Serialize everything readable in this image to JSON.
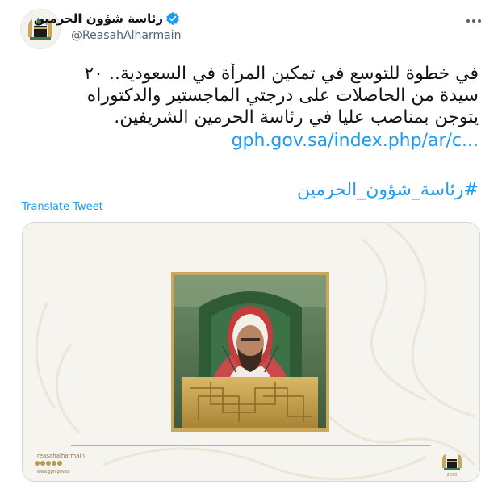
{
  "tweet": {
    "display_name": "رئاسة شؤون الحرمين",
    "handle": "@ReasahAlharmain",
    "verified": true,
    "more_icon": "more-horizontal-icon",
    "text_lines": [
      "في خطوة للتوسع في تمكين المرأة في السعودية.. ٢٠",
      "سيدة من الحاصلات على درجتي الماجستير والدكتوراه",
      "يتوجن بمناصب عليا في رئاسة الحرمين الشريفين."
    ],
    "link": "gph.gov.sa/index.php/ar/c...",
    "hashtag": "#رئاسة_شؤون_الحرمين",
    "translate_label": "Translate Tweet"
  },
  "media": {
    "brand_handle": "reasahalharmain",
    "site": "www.gph.gov.sa",
    "logo_year": "2030",
    "colors": {
      "gold": "#c9a85c",
      "background": "#f6f4ee"
    }
  },
  "colors": {
    "link": "#1d9bf0",
    "text": "#0f1419",
    "muted": "#536471",
    "verified": "#1d9bf0"
  }
}
